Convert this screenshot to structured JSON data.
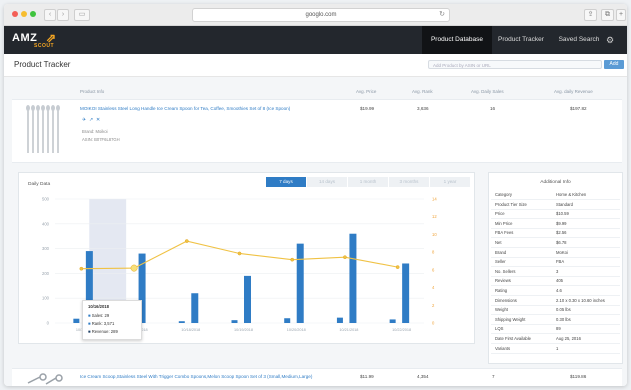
{
  "browser": {
    "address": "googlo.com"
  },
  "header": {
    "logo_text": "AMZ",
    "logo_sub": "SCOUT",
    "nav": [
      "Product Database",
      "Product Tracker",
      "Saved Search"
    ]
  },
  "page": {
    "title": "Product Tracker",
    "add_placeholder": "Add Product by ASIN or URL",
    "add_button": "Add"
  },
  "columns": {
    "info": "Product Info",
    "price": "Avg. Price",
    "rank": "Avg. Rank",
    "daily_sales": "Avg. Daily Sales",
    "daily_revenue": "Avg. daily Revenue"
  },
  "products": [
    {
      "title": "MOIKOI Stainless Steel Long Handle Ice Cream Spoon for Tea, Coffee, Smoothies Set of 8 (Ice Spoon)",
      "price": "$19.99",
      "rank": "3,636",
      "sales": "16",
      "revenue": "$197.82",
      "brand": "Brand: Moikoi",
      "asin": "ASIN: B07F6L87GH"
    },
    {
      "title": "Ice Cream Scoop,Stainless Steel With Trigger Combo Spoons,Melon Scoop Spoon Set of 3 (Small,Medium,Large)",
      "price": "$11.99",
      "rank": "4,354",
      "sales": "7",
      "revenue": "$119.86"
    }
  ],
  "chart_panel": {
    "label": "Daily Data",
    "tabs": [
      "7 days",
      "14 days",
      "1 month",
      "3 months",
      "1 year"
    ],
    "active_tab": "7 days"
  },
  "chart_data": {
    "type": "bar",
    "categories": [
      "10/16/2018",
      "10/17/2018",
      "10/18/2018",
      "10/19/2018",
      "10/20/2018",
      "10/21/2018",
      "10/22/2018"
    ],
    "series": [
      {
        "name": "Sales",
        "values": [
          29,
          28,
          12,
          19,
          32,
          36,
          24
        ]
      },
      {
        "name": "Rank",
        "values": [
          3571,
          3621,
          5800,
          4800,
          4300,
          4500,
          3700
        ]
      },
      {
        "name": "Revenue",
        "values": [
          289,
          280,
          120,
          190,
          320,
          360,
          240
        ]
      }
    ],
    "left_axis_ticks": [
      "500",
      "400",
      "300",
      "200",
      "100",
      "0"
    ],
    "right_axis_ticks": [
      "14",
      "12",
      "10",
      "8",
      "6",
      "4",
      "2",
      "0"
    ],
    "ylim": [
      0,
      500
    ],
    "bar_color": "#2f7cc5",
    "line_color": "#f0c244"
  },
  "tooltip": {
    "date": "10/16/2018",
    "sales": "Sales: 29",
    "rank": "Rank: 3,571",
    "revenue": "Revenue: 289"
  },
  "additional_info": {
    "title": "Additional Info",
    "rows": [
      [
        "Category",
        "Home & Kitchen"
      ],
      [
        "Product Tier Size",
        "Standard"
      ],
      [
        "Price",
        "$10.59"
      ],
      [
        "Min Price",
        "$9.99"
      ],
      [
        "FBA Fees",
        "$2.56"
      ],
      [
        "Net",
        "$6.78"
      ],
      [
        "Brand",
        "MoKoi"
      ],
      [
        "Seller",
        "FBA"
      ],
      [
        "No. Sellers",
        "3"
      ],
      [
        "Reviews",
        "405"
      ],
      [
        "Rating",
        "4.6"
      ],
      [
        "Dimensions",
        "2.10 x 0.30 x 10.60 inches"
      ],
      [
        "Weight",
        "0.05 lbs"
      ],
      [
        "Shipping Weight",
        "0.30 lbs"
      ],
      [
        "LQS",
        "89"
      ],
      [
        "Date First Available",
        "Aug 25, 2016"
      ],
      [
        "Variants",
        "1"
      ]
    ]
  }
}
